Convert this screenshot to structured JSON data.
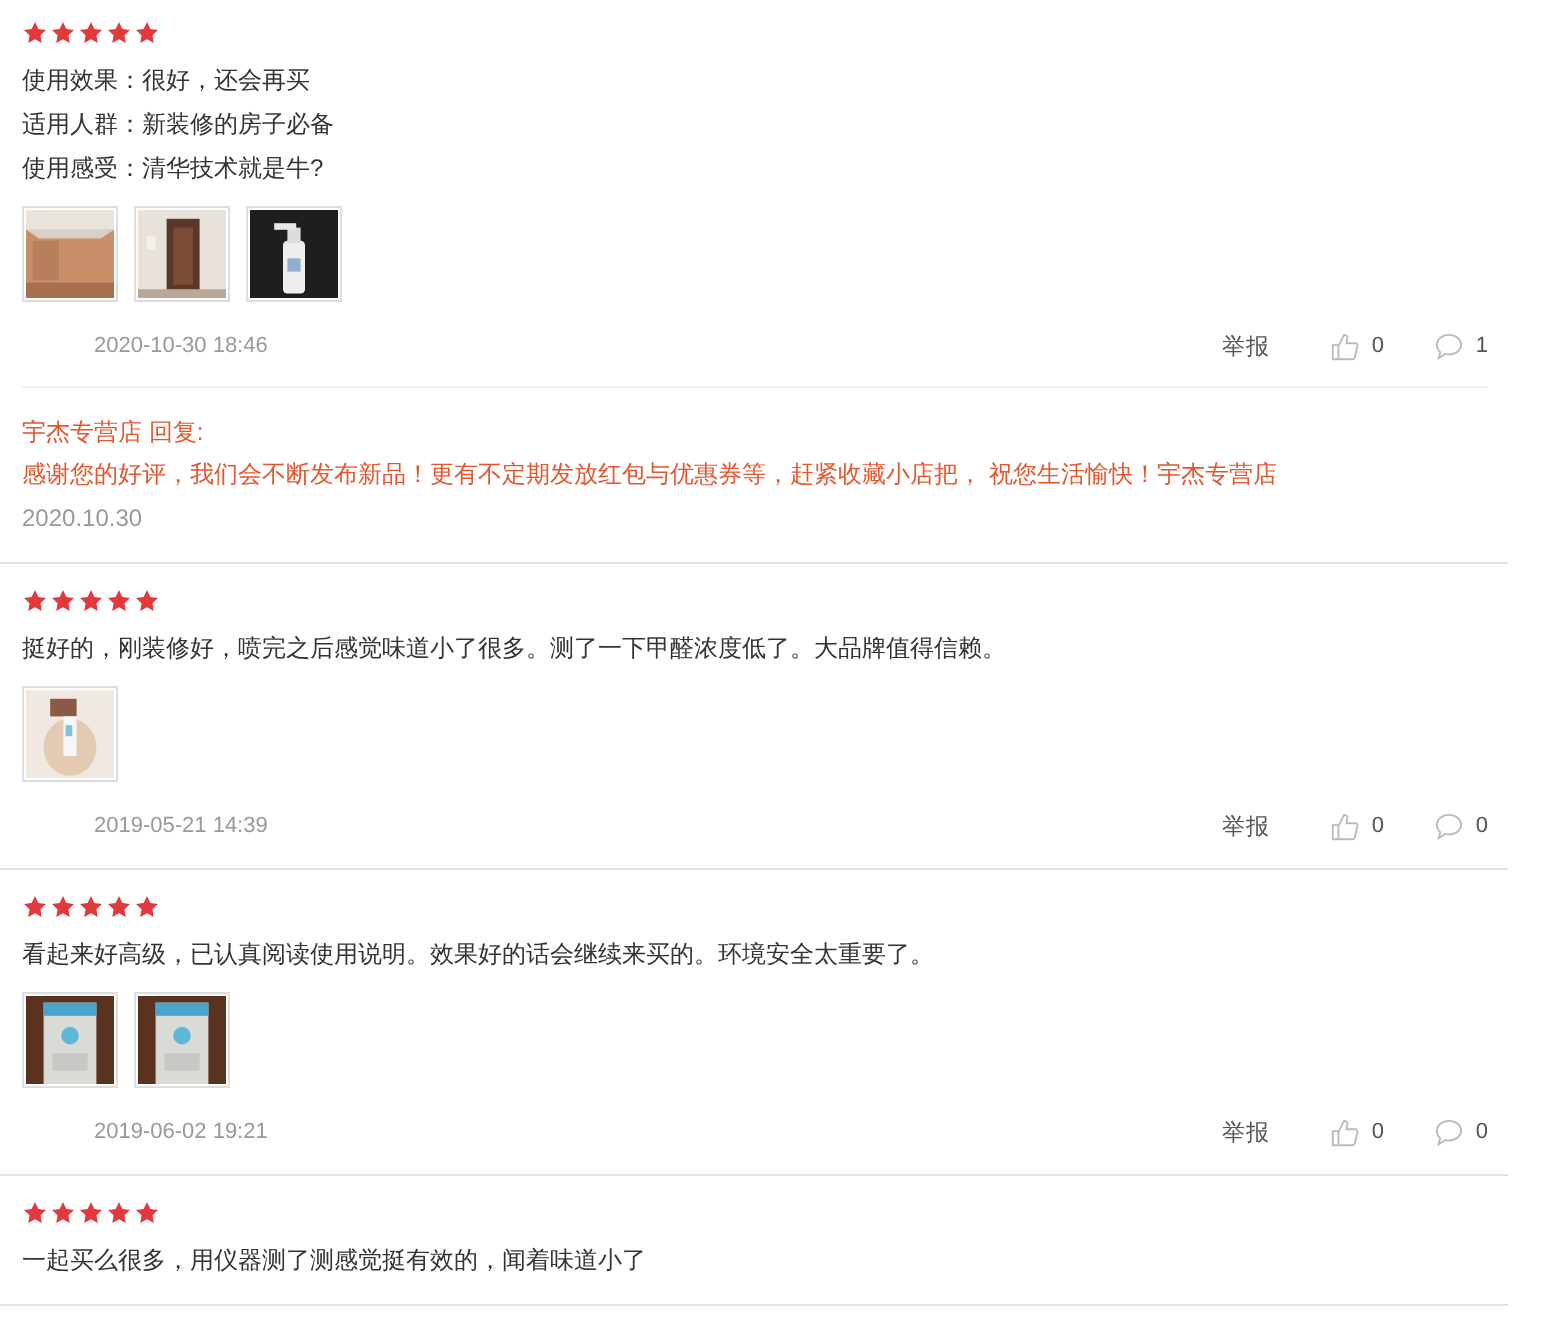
{
  "reviews": [
    {
      "stars": 5,
      "lines": [
        "使用效果：很好，还会再买",
        "适用人群：新装修的房子必备",
        "使用感受：清华技术就是牛?"
      ],
      "photos": [
        {
          "kind": "picture"
        },
        {
          "kind": "picture"
        },
        {
          "kind": "picture"
        }
      ],
      "date": "2020-10-30 18:46",
      "report": "举报",
      "likes": "0",
      "comments": "1",
      "reply": {
        "header": "宇杰专营店 回复:",
        "text": "感谢您的好评，我们会不断发布新品！更有不定期发放红包与优惠券等，赶紧收藏小店把， 祝您生活愉快！宇杰专营店",
        "date": "2020.10.30"
      }
    },
    {
      "stars": 5,
      "lines": [
        "挺好的，刚装修好，喷完之后感觉味道小了很多。测了一下甲醛浓度低了。大品牌值得信赖。"
      ],
      "photos": [
        {
          "kind": "picture"
        }
      ],
      "date": "2019-05-21 14:39",
      "report": "举报",
      "likes": "0",
      "comments": "0"
    },
    {
      "stars": 5,
      "lines": [
        "看起来好高级，已认真阅读使用说明。效果好的话会继续来买的。环境安全太重要了。"
      ],
      "photos": [
        {
          "kind": "picture"
        },
        {
          "kind": "picture"
        }
      ],
      "date": "2019-06-02 19:21",
      "report": "举报",
      "likes": "0",
      "comments": "0"
    },
    {
      "stars": 5,
      "lines": [
        "一起买么很多，用仪器测了测感觉挺有效的，闻着味道小了"
      ]
    }
  ]
}
